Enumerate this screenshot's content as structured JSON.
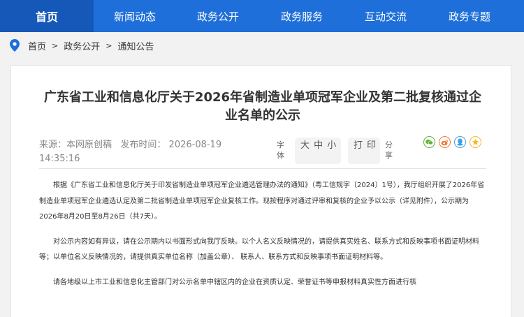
{
  "nav": {
    "items": [
      {
        "label": "首页"
      },
      {
        "label": "新闻动态"
      },
      {
        "label": "政务公开"
      },
      {
        "label": "政务服务"
      },
      {
        "label": "互动交流"
      },
      {
        "label": "政务专题"
      }
    ]
  },
  "breadcrumb": {
    "items": [
      "首页",
      "政务公开",
      "通知公告"
    ],
    "separator": ">"
  },
  "article": {
    "title": "广东省工业和信息化厅关于2026年省制造业单项冠军企业及第二批复核通过企业名单的公示",
    "source": "来源：本网原创稿",
    "published": "发布时间： 2026-08-19 14:35:16",
    "font_label": "字体",
    "font_sizes": "大 中 小",
    "print_label": "打印",
    "share_label": "分享",
    "paragraphs": [
      "根据《广东省工业和信息化厅关于印发省制造业单项冠军企业遴选管理办法的通知》（粤工信规字〔2024〕1号），我厅组织开展了2026年省制造业单项冠军企业遴选认定及第二批省制造业单项冠军企业复核工作。现按程序对通过评审和复核的企业予以公示（详见附件），公示期为2026年8月20日至8月26日（共7天）。",
      "对公示内容如有异议，请在公示期内以书面形式向我厅反映。以个人名义反映情况的，请提供真实姓名、联系方式和反映事项书面证明材料等；以单位名义反映情况的，请提供真实单位名称（加盖公章）、 联系人、联系方式和反映事项书面证明材料等。",
      "请各地级以上市工业和信息化主管部门对公示名单中辖区内的企业在资质认定、荣誉证书等申报材料真实性方面进行核"
    ]
  },
  "colors": {
    "nav_bg": "#1e6fd9",
    "nav_active": "#1658b8",
    "wechat": "#5fb336",
    "weibo": "#f07a3a",
    "qq": "#3fa0e6",
    "qzone": "#f5b82e"
  },
  "icons": {
    "location": "location-pin-icon",
    "share": [
      "wechat-icon",
      "weibo-icon",
      "qq-icon",
      "qzone-star-icon"
    ]
  }
}
